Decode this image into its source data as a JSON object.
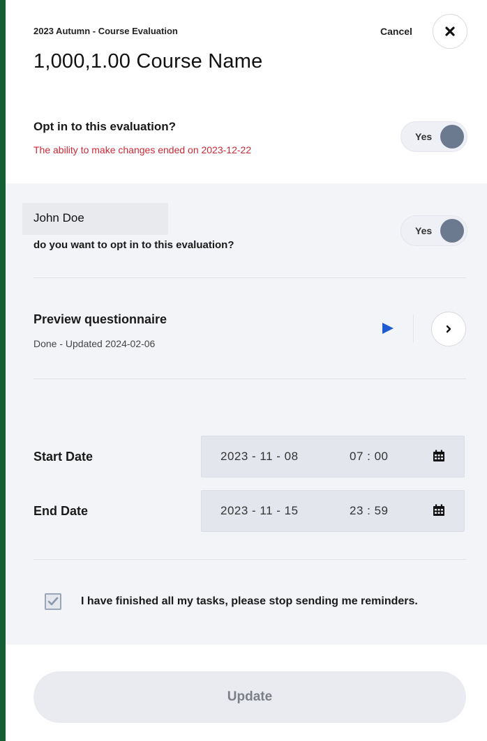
{
  "header": {
    "term_label": "2023 Autumn - Course Evaluation",
    "course_title": "1,000,1.00 Course Name",
    "cancel_label": "Cancel",
    "close_icon": "close-icon"
  },
  "optin": {
    "title": "Opt in to this evaluation?",
    "warning": "The ability to make changes ended on 2023-12-22",
    "toggle_label": "Yes",
    "toggle_on": true
  },
  "person": {
    "name": "John Doe",
    "question": "do you want to opt in to this evaluation?",
    "toggle_label": "Yes",
    "toggle_on": true
  },
  "preview": {
    "title": "Preview questionnaire",
    "status": "Done - Updated 2024-02-06",
    "play_icon": "play-icon",
    "chevron_icon": "chevron-right-icon"
  },
  "dates": {
    "start_label": "Start Date",
    "start_date": "2023 - 11 - 08",
    "start_time": "07 : 00",
    "end_label": "End Date",
    "end_date": "2023 - 11 - 15",
    "end_time": "23 : 59",
    "calendar_icon": "calendar-icon"
  },
  "reminder": {
    "checked": true,
    "label": "I have finished all my tasks, please stop sending me reminders."
  },
  "footer": {
    "update_label": "Update"
  },
  "colors": {
    "brand_bar": "#135e35",
    "warning": "#cc2936",
    "play_accent": "#1f5bd1",
    "toggle_knob": "#6b7a8f",
    "panel_bg": "#f3f4f7"
  }
}
